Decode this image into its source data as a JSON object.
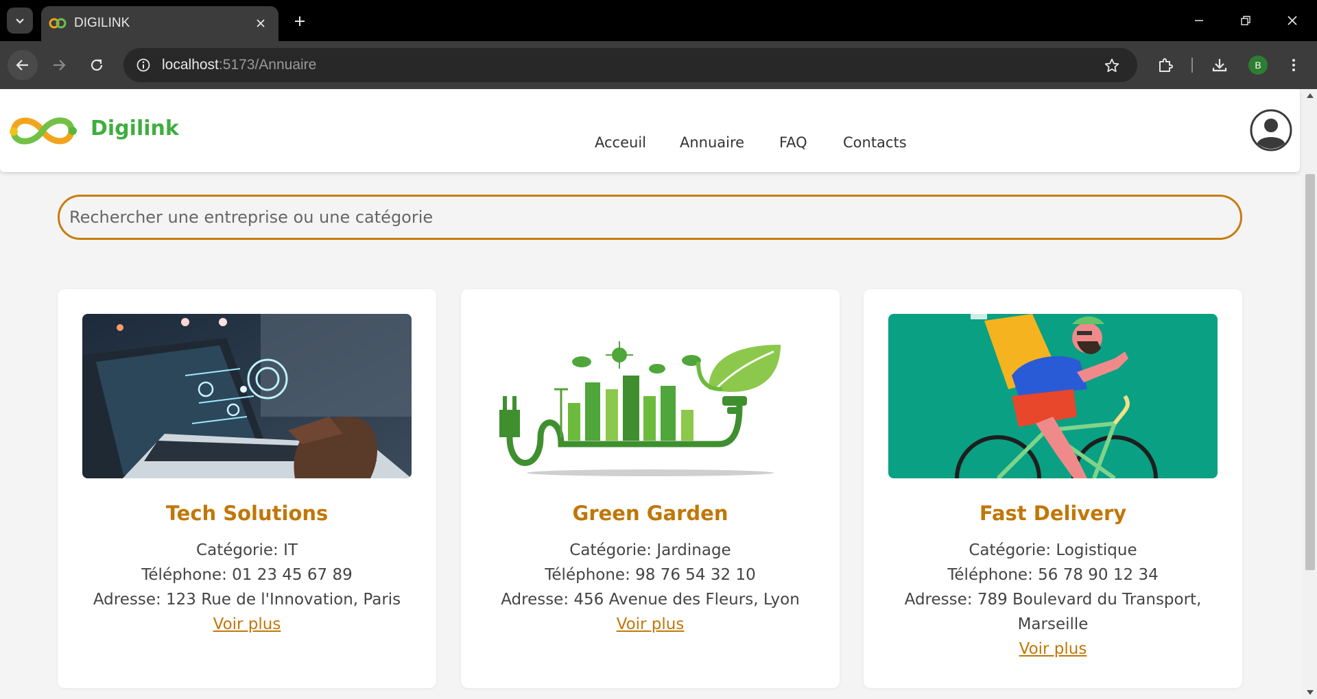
{
  "browser": {
    "tab_title": "DIGILINK",
    "url_host": "localhost",
    "url_path": ":5173/Annuaire",
    "profile_initial": "B"
  },
  "site": {
    "brand": "Digilink",
    "nav": [
      "Acceuil",
      "Annuaire",
      "FAQ",
      "Contacts"
    ],
    "search_placeholder": "Rechercher une entreprise ou une catégorie"
  },
  "cards": [
    {
      "title": "Tech Solutions",
      "category": "Catégorie: IT",
      "phone": "Téléphone: 01 23 45 67 89",
      "address": "Adresse: 123 Rue de l'Innovation, Paris",
      "link": "Voir plus"
    },
    {
      "title": "Green Garden",
      "category": "Catégorie: Jardinage",
      "phone": "Téléphone: 98 76 54 32 10",
      "address": "Adresse: 456 Avenue des Fleurs, Lyon",
      "link": "Voir plus"
    },
    {
      "title": "Fast Delivery",
      "category": "Catégorie: Logistique",
      "phone": "Téléphone: 56 78 90 12 34",
      "address": "Adresse: 789 Boulevard du Transport, Marseille",
      "link": "Voir plus"
    }
  ],
  "colors": {
    "accent": "#c07708",
    "brand_green": "#3fae3f",
    "page_bg": "#f4f4f4"
  },
  "icons": [
    "tab-search-icon",
    "close-icon",
    "plus-icon",
    "minimize-icon",
    "restore-icon",
    "back-icon",
    "forward-icon",
    "reload-icon",
    "info-icon",
    "star-icon",
    "extensions-icon",
    "download-icon",
    "more-icon",
    "user-avatar-icon"
  ]
}
